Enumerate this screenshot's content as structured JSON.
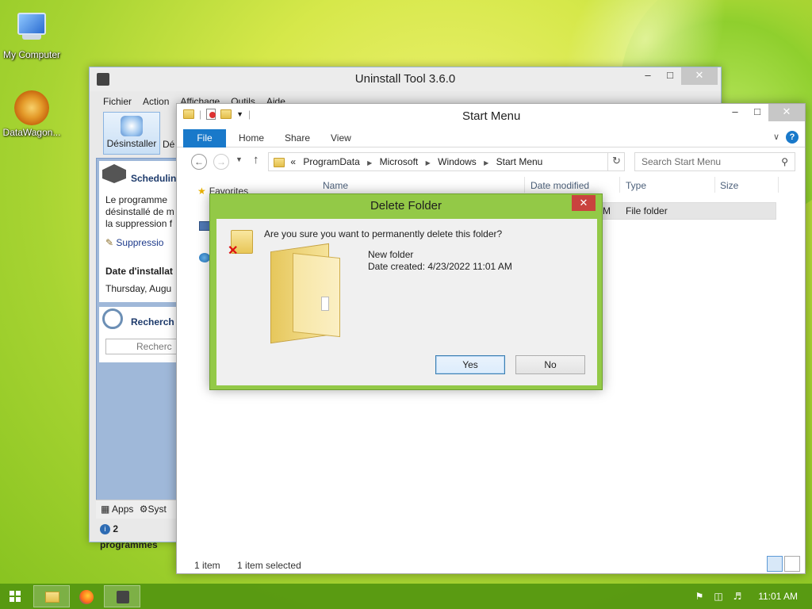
{
  "desktop": {
    "icons": [
      {
        "label": "My Computer"
      },
      {
        "label": "DataWagon..."
      }
    ]
  },
  "uninstall_tool": {
    "title": "Uninstall Tool 3.6.0",
    "menu": [
      "Fichier",
      "Action",
      "Affichage",
      "Outils",
      "Aide"
    ],
    "toolbar": {
      "uninstall_label": "Désinstaller",
      "next_label": "Dé"
    },
    "card": {
      "heading": "Schedulin",
      "lines": [
        "Le programme",
        "désinstallé de m",
        "la suppression f"
      ],
      "link": "Suppressio",
      "date_label": "Date d'installat",
      "date_value": "Thursday, Augu"
    },
    "search": {
      "heading": "Recherch",
      "placeholder": "Recherc"
    },
    "footer_tabs": [
      "Apps",
      "Syst"
    ],
    "status": "2 programmes"
  },
  "explorer": {
    "title": "Start Menu",
    "tabs": {
      "file": "File",
      "home": "Home",
      "share": "Share",
      "view": "View"
    },
    "breadcrumb": [
      "«",
      "ProgramData",
      "Microsoft",
      "Windows",
      "Start Menu"
    ],
    "search_placeholder": "Search Start Menu",
    "columns": {
      "name": "Name",
      "date_modified": "Date modified",
      "type": "Type",
      "size": "Size"
    },
    "favorites_label": "Favorites",
    "row": {
      "date_fragment": "M",
      "type": "File folder"
    },
    "status": {
      "count": "1 item",
      "selected": "1 item selected"
    }
  },
  "dialog": {
    "title": "Delete Folder",
    "question": "Are you sure you want to permanently delete this folder?",
    "folder_name": "New folder",
    "date_created": "Date created: 4/23/2022 11:01 AM",
    "yes_label": "Yes",
    "no_label": "No",
    "close_label": "✕"
  },
  "taskbar": {
    "clock": "11:01 AM"
  }
}
